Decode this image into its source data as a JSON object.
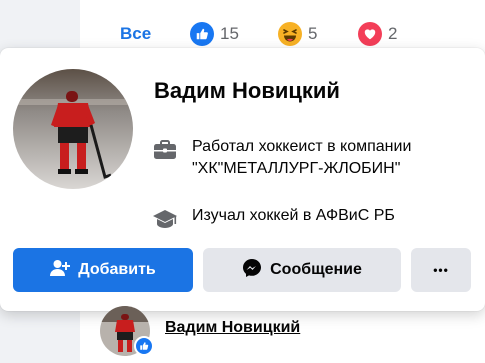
{
  "reactions_bar": {
    "all_label": "Все",
    "like": {
      "icon": "like-icon",
      "count": "15",
      "color": "#1877f2"
    },
    "haha": {
      "icon": "haha-icon",
      "count": "5",
      "color": "#f7b125"
    },
    "love": {
      "icon": "love-icon",
      "count": "2",
      "color": "#f33e58"
    }
  },
  "profile_card": {
    "name": "Вадим Новицкий",
    "work": {
      "icon": "briefcase-icon",
      "text_line1": "Работал хоккеист в компании",
      "text_line2": "\"ХК\"МЕТАЛЛУРГ-ЖЛОБИН\""
    },
    "education": {
      "icon": "graduation-cap-icon",
      "text": "Изучал хоккей в АФВиС РБ"
    },
    "buttons": {
      "add_label": "Добавить",
      "message_label": "Сообщение",
      "more_label": "•••"
    }
  },
  "comment_author": {
    "name": "Вадим Новицкий",
    "badge_icon": "like-icon"
  },
  "colors": {
    "accent": "#1b74e4",
    "secondary_button": "#e4e6eb",
    "background": "#f0f2f5"
  }
}
